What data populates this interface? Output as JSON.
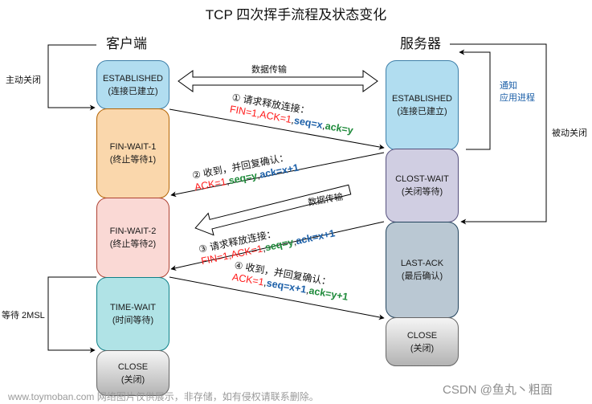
{
  "title": "TCP 四次挥手流程及状态变化",
  "client": {
    "heading": "客户端",
    "active_close_label": "主动关闭",
    "wait_label": "等待 2MSL",
    "states": [
      {
        "name": "ESTABLISHED",
        "desc": "(连接已建立)",
        "color": "#b1ddf0"
      },
      {
        "name": "FIN-WAIT-1",
        "desc": "(终止等待1)",
        "color": "#fad7ac"
      },
      {
        "name": "FIN-WAIT-2",
        "desc": "(终止等待2)",
        "color": "#fad9d5"
      },
      {
        "name": "TIME-WAIT",
        "desc": "(时间等待)",
        "color": "#b0e3e6"
      },
      {
        "name": "CLOSE",
        "desc": "(关闭)",
        "color": "#cccccc"
      }
    ]
  },
  "server": {
    "heading": "服务器",
    "notify_label_1": "通知",
    "notify_label_2": "应用进程",
    "passive_close_label": "被动关闭",
    "states": [
      {
        "name": "ESTABLISHED",
        "desc": "(连接已建立)",
        "color": "#b1ddf0"
      },
      {
        "name": "CLOST-WAIT",
        "desc": "(关闭等待)",
        "color": "#d0cee2"
      },
      {
        "name": "LAST-ACK",
        "desc": "(最后确认)",
        "color": "#bac8d3"
      },
      {
        "name": "CLOSE",
        "desc": "(关闭)",
        "color": "#cccccc"
      }
    ]
  },
  "data_transfer_label": "数据传输",
  "data_transfer_label_2": "数据传输",
  "messages": [
    {
      "step": "① 请求释放连接：",
      "parts": [
        {
          "text": "FIN=1,ACK=1",
          "style": "red"
        },
        {
          "text": ",",
          "style": "plain"
        },
        {
          "text": "seq=x",
          "style": "blue"
        },
        {
          "text": ",",
          "style": "plain"
        },
        {
          "text": "ack=y",
          "style": "green"
        }
      ]
    },
    {
      "step": "② 收到，并回复确认：",
      "parts": [
        {
          "text": "ACK=1",
          "style": "red"
        },
        {
          "text": ",",
          "style": "plain"
        },
        {
          "text": "seq=y",
          "style": "green"
        },
        {
          "text": ",",
          "style": "plain"
        },
        {
          "text": "ack=x+1",
          "style": "blue"
        }
      ]
    },
    {
      "step": "③ 请求释放连接：",
      "parts": [
        {
          "text": "FIN=1,ACK=1",
          "style": "red"
        },
        {
          "text": ",",
          "style": "plain"
        },
        {
          "text": "seq=y",
          "style": "green"
        },
        {
          "text": ",",
          "style": "plain"
        },
        {
          "text": "ack=x+1",
          "style": "blue"
        }
      ]
    },
    {
      "step": "④ 收到，并回复确认：",
      "parts": [
        {
          "text": "ACK=1",
          "style": "red"
        },
        {
          "text": ",",
          "style": "plain"
        },
        {
          "text": "seq=x+1",
          "style": "blue"
        },
        {
          "text": ",",
          "style": "plain"
        },
        {
          "text": "ack=y+1",
          "style": "green"
        }
      ]
    }
  ],
  "watermark": "www.toymoban.com 网络图片仅供展示，非存储，如有侵权请联系删除。",
  "credit": "CSDN @鱼丸丶粗面"
}
